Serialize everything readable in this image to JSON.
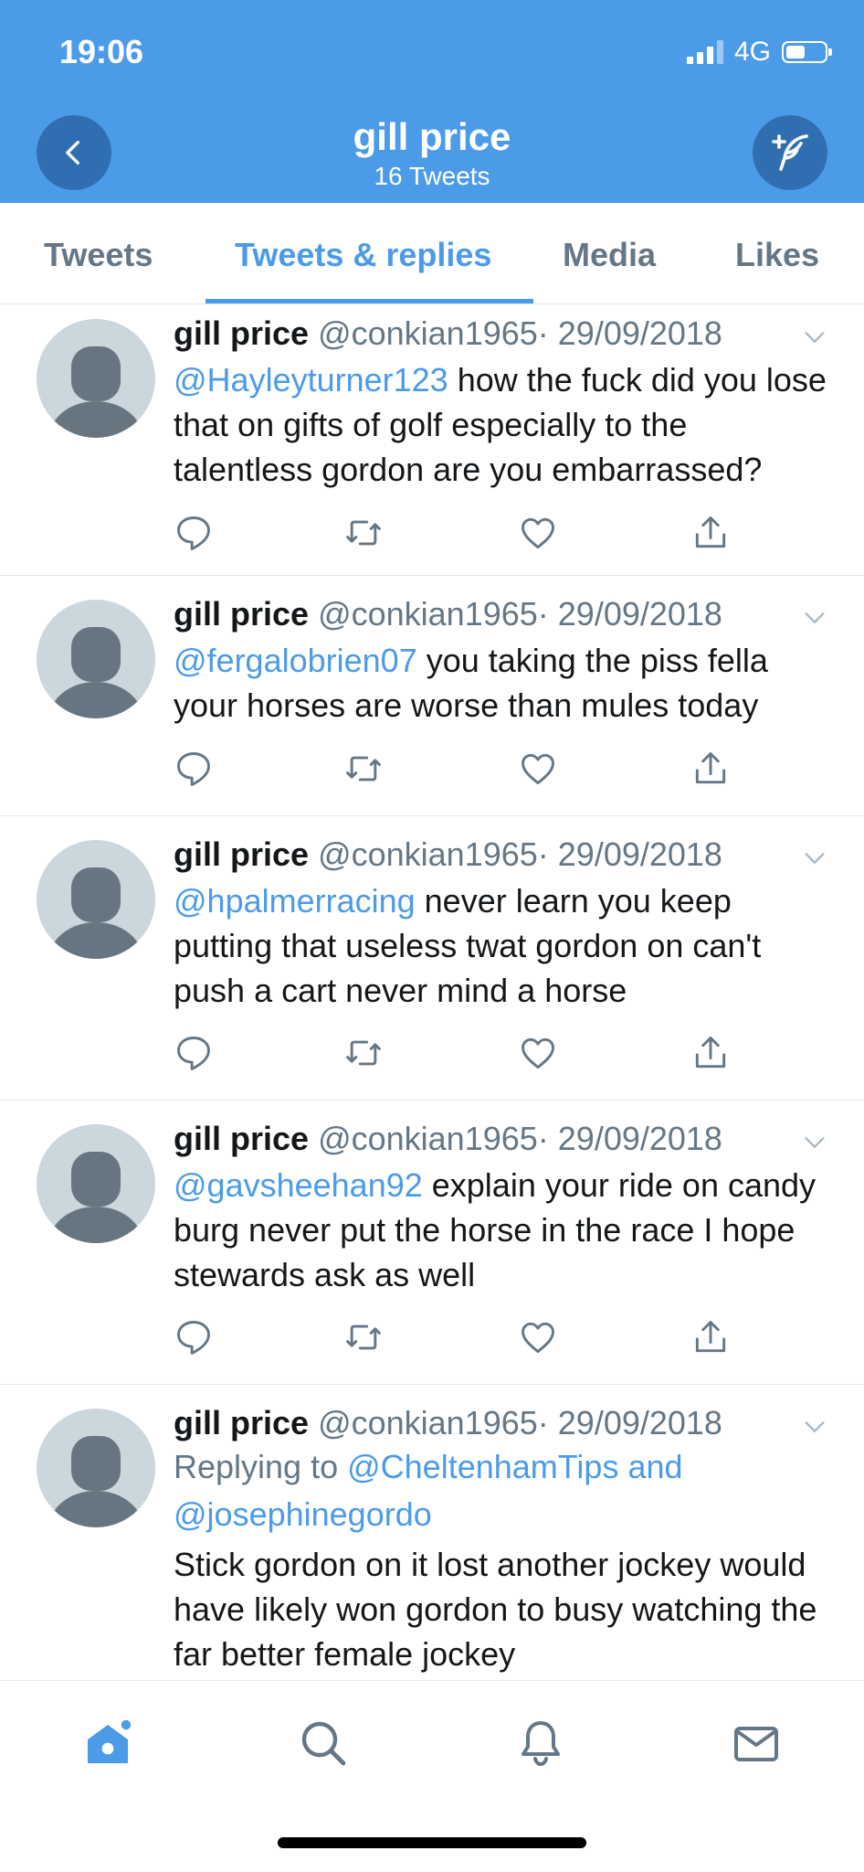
{
  "status_bar": {
    "time": "19:06",
    "network": "4G"
  },
  "header": {
    "title": "gill price",
    "subtitle": "16 Tweets",
    "back_icon": "chevron-left-icon",
    "compose_icon": "compose-tweet-icon",
    "background_color": "#4c9be8"
  },
  "tabs": [
    {
      "label": "Tweets",
      "active": false
    },
    {
      "label": "Tweets & replies",
      "active": true
    },
    {
      "label": "Media",
      "active": false
    },
    {
      "label": "Likes",
      "active": false
    }
  ],
  "tweets": [
    {
      "name": "gill price",
      "handle": "@conkian1965",
      "date": "· 29/09/2018",
      "mention": "@Hayleyturner123",
      "text": " how the fuck did you lose that on gifts of golf especially to the talentless gordon are you embarrassed?"
    },
    {
      "name": "gill price",
      "handle": "@conkian1965",
      "date": "· 29/09/2018",
      "mention": "@fergalobrien07",
      "text": " you taking the piss fella your horses are worse than mules today"
    },
    {
      "name": "gill price",
      "handle": "@conkian1965",
      "date": "· 29/09/2018",
      "mention": "@hpalmerracing",
      "text": " never learn you keep putting that useless twat gordon on can't push a cart never mind a horse"
    },
    {
      "name": "gill price",
      "handle": "@conkian1965",
      "date": "· 29/09/2018",
      "mention": "@gavsheehan92",
      "text": " explain your ride on candy burg  never put the horse in the race I hope stewards ask as well"
    },
    {
      "name": "gill price",
      "handle": "@conkian1965",
      "date": "· 29/09/2018",
      "replying_prefix": "Replying to ",
      "replying_to": "@CheltenhamTips and @josephinegordo",
      "text": "Stick gordon on it lost another jockey would have likely won gordon to busy watching the far better female jockey"
    }
  ],
  "bottom_nav": [
    {
      "icon": "home-icon",
      "active": true
    },
    {
      "icon": "search-icon",
      "active": false
    },
    {
      "icon": "notifications-bell-icon",
      "active": false
    },
    {
      "icon": "messages-envelope-icon",
      "active": false
    }
  ],
  "colors": {
    "accent": "#4c9be8",
    "secondary_text": "#657786",
    "divider": "#e1e8ed"
  }
}
